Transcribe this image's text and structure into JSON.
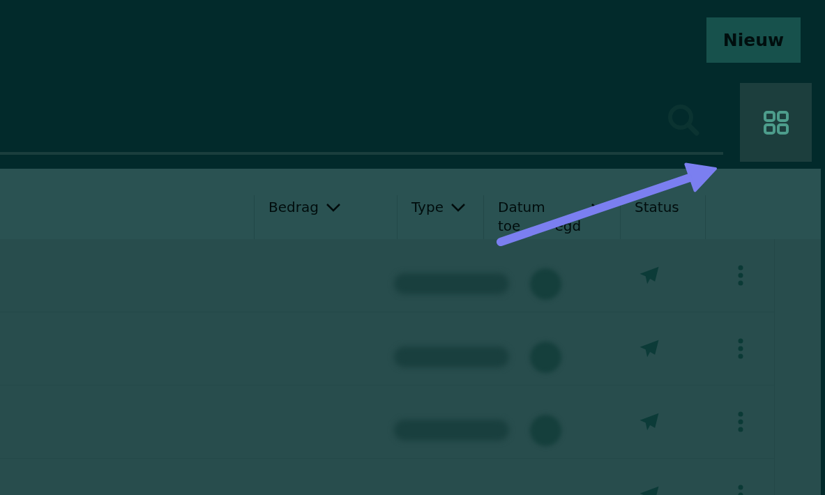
{
  "header": {
    "new_button": "Nieuw"
  },
  "toolbar": {
    "grid_view_button": {
      "highlighted": true
    }
  },
  "table": {
    "columns": [
      {
        "label": [
          "Bedrag"
        ],
        "sortable": true
      },
      {
        "label": [
          "Type"
        ],
        "sortable": true
      },
      {
        "label": [
          "Datum",
          "toe",
          "egd"
        ],
        "sortable": true
      },
      {
        "label": [
          "Status"
        ],
        "sortable": false
      }
    ],
    "rows": [
      {
        "sent": true,
        "redacted": true
      },
      {
        "sent": true,
        "redacted": true
      },
      {
        "sent": true,
        "redacted": true
      },
      {
        "sent": true,
        "redacted": false
      }
    ]
  }
}
